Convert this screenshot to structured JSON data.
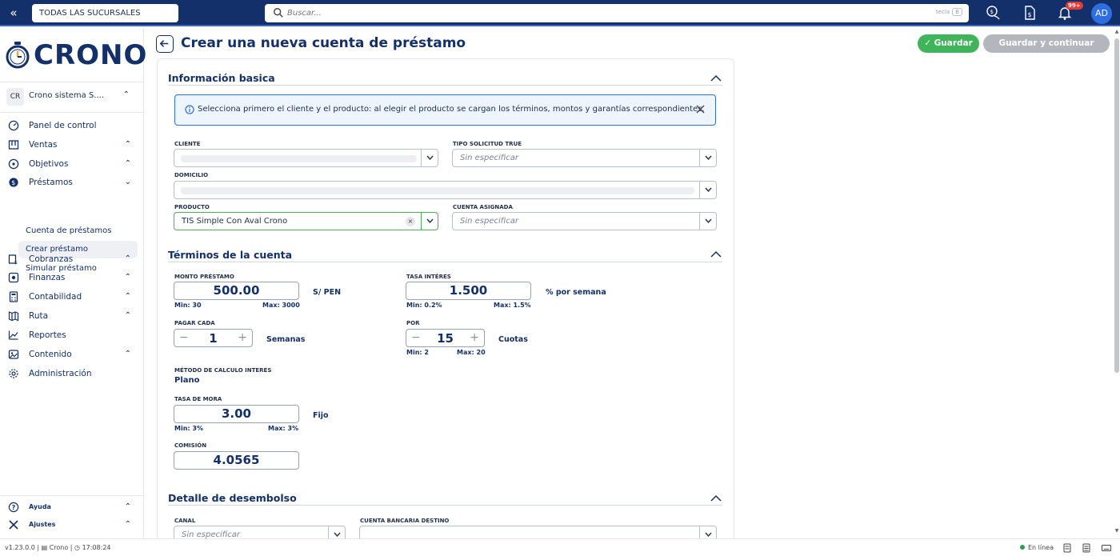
{
  "topbar": {
    "branch": "TODAS LAS SUCURSALES",
    "search_placeholder": "Buscar...",
    "search_hint": "tecla",
    "search_key": "B",
    "notifications_badge": "99+",
    "avatar": "AD"
  },
  "sidebar": {
    "logo": "CRONO",
    "company_initials": "CR",
    "company_name": "Crono sistema S....",
    "nav": [
      {
        "label": "Panel de control",
        "icon": "dashboard-icon"
      },
      {
        "label": "Ventas",
        "icon": "store-icon"
      },
      {
        "label": "Objetivos",
        "icon": "target-icon"
      },
      {
        "label": "Préstamos",
        "icon": "loan-icon"
      },
      {
        "label": "Cobranzas",
        "icon": "collections-icon"
      },
      {
        "label": "Finanzas",
        "icon": "finance-icon"
      },
      {
        "label": "Contabilidad",
        "icon": "calculator-icon"
      },
      {
        "label": "Ruta",
        "icon": "route-icon"
      },
      {
        "label": "Reportes",
        "icon": "chart-icon"
      },
      {
        "label": "Contenido",
        "icon": "content-icon"
      },
      {
        "label": "Administración",
        "icon": "gear-icon"
      }
    ],
    "loan_subitems": [
      "Cuenta de préstamos",
      "Crear préstamo",
      "Simular préstamo"
    ],
    "footer": [
      "Ayuda",
      "Ajustes"
    ]
  },
  "page": {
    "title": "Crear una nueva cuenta de préstamo",
    "save": "Guardar",
    "save_continue": "Guardar y continuar editando"
  },
  "basic": {
    "title": "Información basica",
    "info": "Selecciona primero el cliente y el producto: al elegir el producto se cargan los términos, montos y garantías correspondientes.",
    "cliente_label": "CLIENTE",
    "tipo_label": "TIPO SOLICITUD TRUE",
    "tipo_placeholder": "Sin especificar",
    "domicilio_label": "DOMICILIO",
    "producto_label": "PRODUCTO",
    "producto_value": "TIS Simple Con Aval Crono",
    "cuenta_label": "CUENTA ASIGNADA",
    "cuenta_placeholder": "Sin especificar"
  },
  "terms": {
    "title": "Términos de la cuenta",
    "monto_label": "MONTO PRÉSTAMO",
    "monto_value": "500.00",
    "monto_unit": "S/ PEN",
    "monto_min": "Min: 30",
    "monto_max": "Max: 3000",
    "tasa_label": "TASA INTÉRES",
    "tasa_value": "1.500",
    "tasa_unit": "% por semana",
    "tasa_min": "Min: 0.2%",
    "tasa_max": "Max: 1.5%",
    "pagar_label": "PAGAR CADA",
    "pagar_value": "1",
    "pagar_unit": "Semanas",
    "por_label": "POR",
    "por_value": "15",
    "por_unit": "Cuotas",
    "por_min": "Min: 2",
    "por_max": "Max: 20",
    "metodo_label": "MÉTODO DE CALCULO INTERES",
    "metodo_value": "Plano",
    "mora_label": "TASA DE MORA",
    "mora_value": "3.00",
    "mora_unit": "Fijo",
    "mora_min": "Min: 3%",
    "mora_max": "Max: 3%",
    "comision_label": "COMISIÓN",
    "comision_value": "4.0565"
  },
  "disbursement": {
    "title": "Detalle de desembolso",
    "canal_label": "CANAL",
    "canal_placeholder": "Sin especificar",
    "cuenta_label": "CUENTA BANCARIA DESTINO"
  },
  "status": {
    "version": "v1.23.0.0",
    "app": "Crono",
    "time": "17:08:24",
    "online": "En línea"
  },
  "colors": {
    "primary": "#13306b",
    "success": "#3fb45b",
    "accent": "#2f6ee0"
  }
}
